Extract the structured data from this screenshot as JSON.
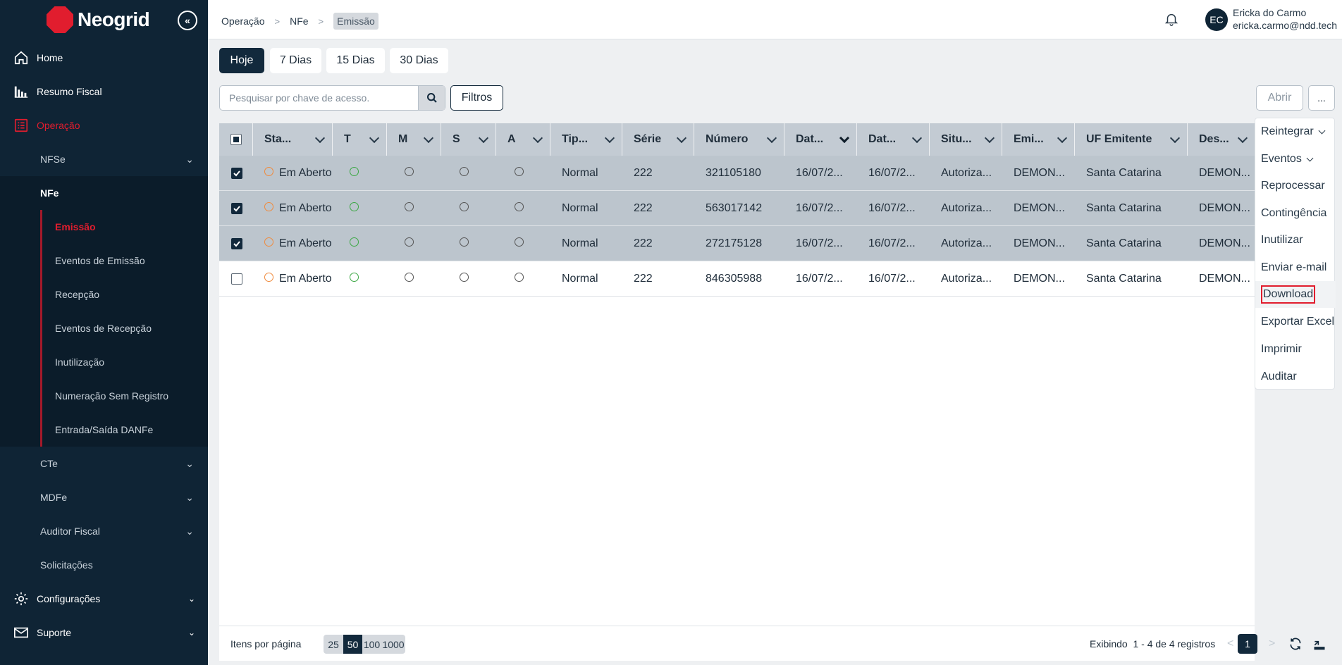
{
  "brand": {
    "name": "Neogrid",
    "accent": "#e11d2e"
  },
  "sidebar": {
    "items": [
      {
        "label": "Home",
        "icon": "home-icon"
      },
      {
        "label": "Resumo Fiscal",
        "icon": "chart-icon"
      },
      {
        "label": "Operação",
        "icon": "list-icon"
      },
      {
        "label": "Configurações",
        "icon": "gear-icon"
      },
      {
        "label": "Suporte",
        "icon": "mail-icon"
      }
    ],
    "operacao": {
      "nfse": "NFSe",
      "nfe": "NFe",
      "nfe_children": [
        "Emissão",
        "Eventos de Emissão",
        "Recepção",
        "Eventos de Recepção",
        "Inutilização",
        "Numeração Sem Registro",
        "Entrada/Saída DANFe"
      ],
      "cte": "CTe",
      "mdfe": "MDFe",
      "auditor": "Auditor Fiscal",
      "solicitacoes": "Solicitações"
    }
  },
  "breadcrumb": [
    "Operação",
    "NFe",
    "Emissão"
  ],
  "user": {
    "initials": "EC",
    "name": "Ericka do Carmo",
    "email": "ericka.carmo@ndd.tech"
  },
  "period_tabs": [
    "Hoje",
    "7 Dias",
    "15 Dias",
    "30 Dias"
  ],
  "search": {
    "placeholder": "Pesquisar por chave de acesso."
  },
  "toolbar": {
    "filtros": "Filtros",
    "abrir": "Abrir",
    "more": "..."
  },
  "table": {
    "columns": [
      "Sta...",
      "T",
      "M",
      "S",
      "A",
      "Tip...",
      "Série",
      "Número",
      "Dat...",
      "Dat...",
      "Situ...",
      "Emi...",
      "UF Emitente",
      "Des..."
    ],
    "rows": [
      {
        "selected": true,
        "status": "Em Aberto",
        "tipo": "Normal",
        "serie": "222",
        "numero": "321105180",
        "data1": "16/07/2...",
        "data2": "16/07/2...",
        "situacao": "Autoriza...",
        "emitente": "DEMON...",
        "uf": "Santa Catarina",
        "dest": "DEMON..."
      },
      {
        "selected": true,
        "status": "Em Aberto",
        "tipo": "Normal",
        "serie": "222",
        "numero": "563017142",
        "data1": "16/07/2...",
        "data2": "16/07/2...",
        "situacao": "Autoriza...",
        "emitente": "DEMON...",
        "uf": "Santa Catarina",
        "dest": "DEMON..."
      },
      {
        "selected": true,
        "status": "Em Aberto",
        "tipo": "Normal",
        "serie": "222",
        "numero": "272175128",
        "data1": "16/07/2...",
        "data2": "16/07/2...",
        "situacao": "Autoriza...",
        "emitente": "DEMON...",
        "uf": "Santa Catarina",
        "dest": "DEMON..."
      },
      {
        "selected": false,
        "status": "Em Aberto",
        "tipo": "Normal",
        "serie": "222",
        "numero": "846305988",
        "data1": "16/07/2...",
        "data2": "16/07/2...",
        "situacao": "Autoriza...",
        "emitente": "DEMON...",
        "uf": "Santa Catarina",
        "dest": "DEMON..."
      }
    ]
  },
  "footer": {
    "per_page_label": "Itens por página",
    "per_page_options": [
      "25",
      "50",
      "100",
      "1000"
    ],
    "per_page_selected": "50",
    "showing": "Exibindo  1 - 4 de 4 registros",
    "current_page": "1"
  },
  "dropdown": {
    "items": [
      "Reintegrar",
      "Eventos",
      "Reprocessar",
      "Contingência",
      "Inutilizar",
      "Enviar e-mail",
      "Download",
      "Exportar Excel",
      "Imprimir",
      "Auditar"
    ],
    "highlighted": "Download"
  }
}
